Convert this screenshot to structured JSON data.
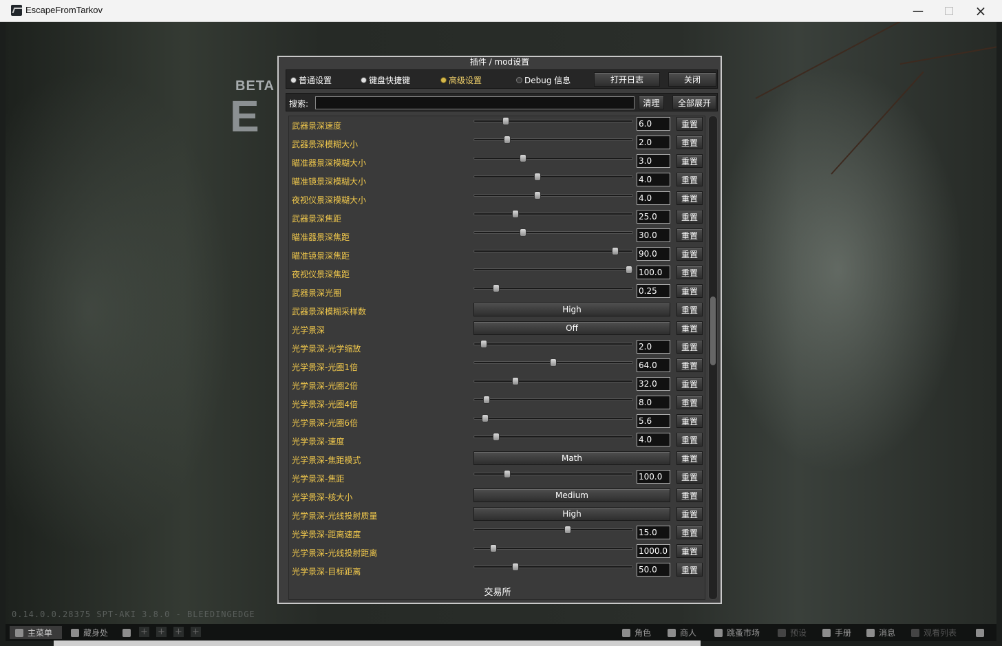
{
  "window": {
    "title": "EscapeFromTarkov"
  },
  "background": {
    "beta_text": "BETA",
    "letter": "E",
    "version": "0.14.0.0.28375 SPT-AKI 3.8.0 - BLEEDINGEDGE"
  },
  "dialog": {
    "title": "插件 / mod设置",
    "tabs": [
      {
        "label": "普通设置",
        "state": "unselected"
      },
      {
        "label": "键盘快捷键",
        "state": "unselected"
      },
      {
        "label": "高级设置",
        "state": "selected"
      },
      {
        "label": "Debug 信息",
        "state": "off"
      }
    ],
    "open_log_label": "打开日志",
    "close_label": "关闭",
    "search_label": "搜索:",
    "search_value": "",
    "clear_label": "清理",
    "expand_all_label": "全部展开",
    "reset_label": "重置",
    "settings": [
      {
        "label": "武器景深速度",
        "kind": "slider",
        "value": "6.0",
        "fraction": 0.2
      },
      {
        "label": "武器景深模糊大小",
        "kind": "slider",
        "value": "2.0",
        "fraction": 0.21
      },
      {
        "label": "瞄准器景深模糊大小",
        "kind": "slider",
        "value": "3.0",
        "fraction": 0.31
      },
      {
        "label": "瞄准镜景深模糊大小",
        "kind": "slider",
        "value": "4.0",
        "fraction": 0.4
      },
      {
        "label": "夜视仪景深模糊大小",
        "kind": "slider",
        "value": "4.0",
        "fraction": 0.4
      },
      {
        "label": "武器景深焦距",
        "kind": "slider",
        "value": "25.0",
        "fraction": 0.26
      },
      {
        "label": "瞄准器景深焦距",
        "kind": "slider",
        "value": "30.0",
        "fraction": 0.31
      },
      {
        "label": "瞄准镜景深焦距",
        "kind": "slider",
        "value": "90.0",
        "fraction": 0.89
      },
      {
        "label": "夜视仪景深焦距",
        "kind": "slider",
        "value": "100.0",
        "fraction": 0.98
      },
      {
        "label": "武器景深光圈",
        "kind": "slider",
        "value": "0.25",
        "fraction": 0.14
      },
      {
        "label": "武器景深模糊采样数",
        "kind": "dropdown",
        "value": "High"
      },
      {
        "label": "光学景深",
        "kind": "dropdown",
        "value": "Off"
      },
      {
        "label": "光学景深-光学缩放",
        "kind": "slider",
        "value": "2.0",
        "fraction": 0.06
      },
      {
        "label": "光学景深-光圈1倍",
        "kind": "slider",
        "value": "64.0",
        "fraction": 0.5
      },
      {
        "label": "光学景深-光圈2倍",
        "kind": "slider",
        "value": "32.0",
        "fraction": 0.26
      },
      {
        "label": "光学景深-光圈4倍",
        "kind": "slider",
        "value": "8.0",
        "fraction": 0.08
      },
      {
        "label": "光学景深-光圈6倍",
        "kind": "slider",
        "value": "5.6",
        "fraction": 0.07
      },
      {
        "label": "光学景深-速度",
        "kind": "slider",
        "value": "4.0",
        "fraction": 0.14
      },
      {
        "label": "光学景深-焦距模式",
        "kind": "dropdown",
        "value": "Math"
      },
      {
        "label": "光学景深-焦距",
        "kind": "slider",
        "value": "100.0",
        "fraction": 0.21
      },
      {
        "label": "光学景深-核大小",
        "kind": "dropdown",
        "value": "Medium"
      },
      {
        "label": "光学景深-光线投射质量",
        "kind": "dropdown",
        "value": "High"
      },
      {
        "label": "光学景深-距离速度",
        "kind": "slider",
        "value": "15.0",
        "fraction": 0.59
      },
      {
        "label": "光学景深-光线投射距离",
        "kind": "slider",
        "value": "1000.0",
        "fraction": 0.12
      },
      {
        "label": "光学景深-目标距离",
        "kind": "slider",
        "value": "50.0",
        "fraction": 0.26
      }
    ],
    "section_label": "交易所"
  },
  "taskbar": {
    "items": [
      {
        "label": "主菜单",
        "icon": "menu-icon"
      },
      {
        "label": "藏身处",
        "icon": "hideout-icon"
      },
      {
        "label": "角色",
        "icon": "character-icon"
      },
      {
        "label": "商人",
        "icon": "traders-icon"
      },
      {
        "label": "跳蚤市场",
        "icon": "flea-market-icon"
      },
      {
        "label": "预设",
        "icon": "presets-icon"
      },
      {
        "label": "手册",
        "icon": "handbook-icon"
      },
      {
        "label": "消息",
        "icon": "messages-icon"
      },
      {
        "label": "观看列表",
        "icon": "watchlist-icon"
      }
    ]
  }
}
